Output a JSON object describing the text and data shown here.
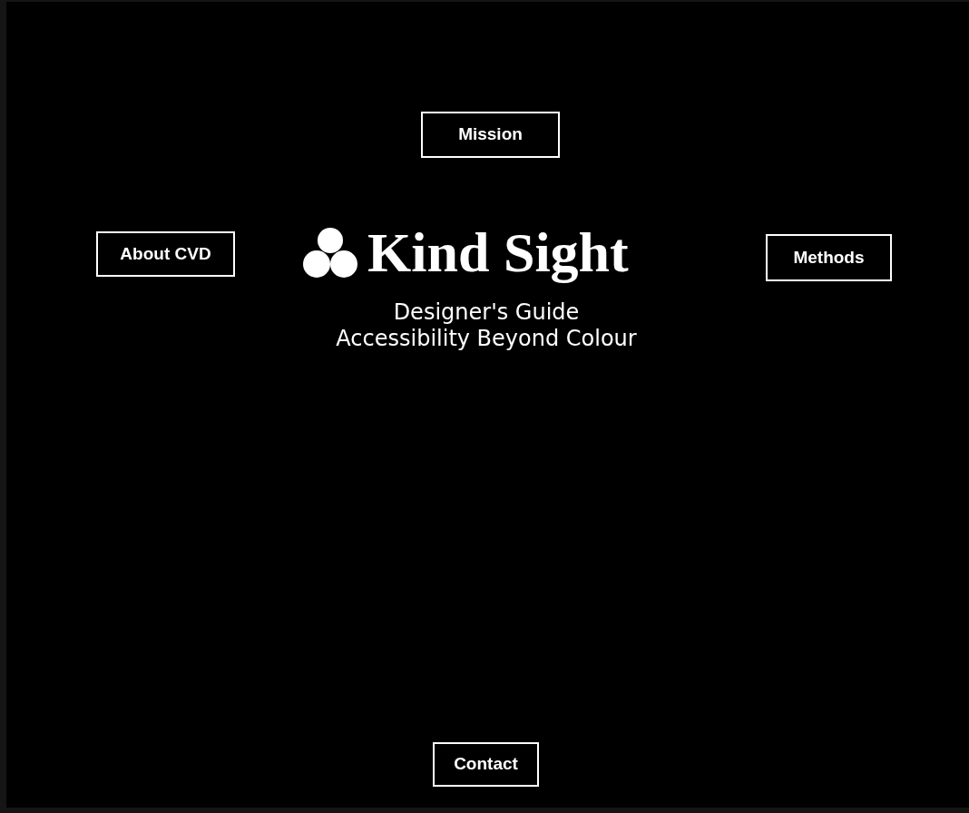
{
  "nav": [
    {
      "label": "Mission"
    },
    {
      "label": "About CVD"
    },
    {
      "label": "Methods"
    },
    {
      "label": "Contact"
    }
  ],
  "logo": {
    "title": "Kind Sight"
  },
  "subtitle": [
    "Designer's Guide",
    "Accessibility Beyond Colour"
  ]
}
